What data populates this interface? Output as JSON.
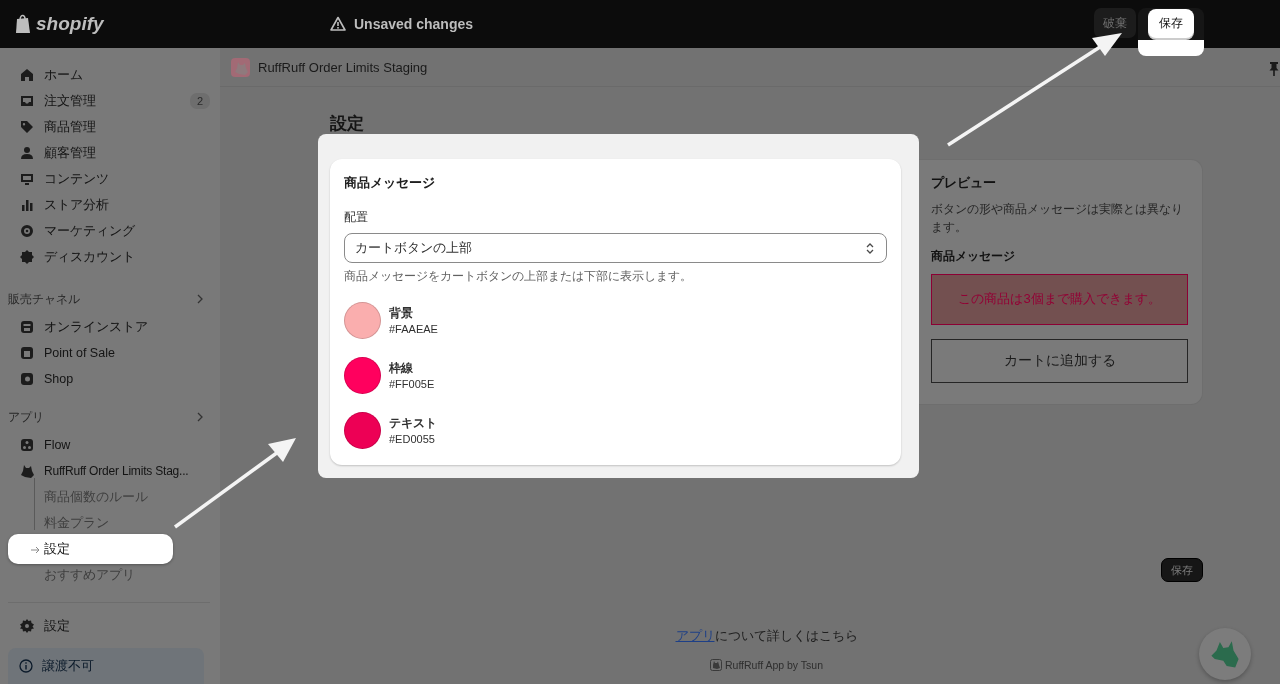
{
  "topbar": {
    "logo": "shopify",
    "status": "Unsaved changes",
    "buttons": [
      {
        "label": "破棄",
        "kind": "secondary"
      },
      {
        "label": "保存",
        "kind": "primary"
      }
    ]
  },
  "sidebar": {
    "items": [
      {
        "label": "ホーム"
      },
      {
        "label": "注文管理",
        "badge": "2"
      },
      {
        "label": "商品管理"
      },
      {
        "label": "顧客管理"
      },
      {
        "label": "コンテンツ"
      },
      {
        "label": "ストア分析"
      },
      {
        "label": "マーケティング"
      },
      {
        "label": "ディスカウント"
      }
    ],
    "sections": [
      {
        "title": "販売チャネル",
        "items": [
          {
            "label": "オンラインストア"
          },
          {
            "label": "Point of Sale"
          },
          {
            "label": "Shop"
          }
        ]
      },
      {
        "title": "アプリ",
        "items": [
          {
            "label": "Flow"
          },
          {
            "label": "RuffRuff Order Limits Stag...",
            "children": [
              {
                "label": "商品個数のルール",
                "selected": false
              },
              {
                "label": "料金プラン",
                "selected": false
              },
              {
                "label": "設定",
                "selected": true
              },
              {
                "label": "おすすめアプリ",
                "selected": false
              }
            ]
          }
        ]
      }
    ],
    "settings": "設定",
    "notice": "譲渡不可"
  },
  "app_header": {
    "title": "RuffRuff Order Limits Staging"
  },
  "page": {
    "title": "設定",
    "message_card": {
      "title": "商品メッセージ",
      "placement_label": "配置",
      "placement_value": "カートボタンの上部",
      "help": "商品メッセージをカートボタンの上部または下部に表示します。",
      "colors": [
        {
          "name": "背景",
          "hex": "#FAAEAE",
          "color": "#faaeae"
        },
        {
          "name": "枠線",
          "hex": "#FF005E",
          "color": "#ff005e"
        },
        {
          "name": "テキスト",
          "hex": "#ED0055",
          "color": "#ed0055"
        }
      ]
    },
    "preview": {
      "title": "プレビュー",
      "note": "ボタンの形や商品メッセージは実際とは異なります。",
      "subtitle": "商品メッセージ",
      "message": "この商品は3個まで購入できます。",
      "cart_button": "カートに追加する"
    },
    "save_button": "保存",
    "footer": {
      "link": "アプリ",
      "text": "について詳しくはこちら",
      "credit": "RuffRuff App by Tsun"
    }
  }
}
